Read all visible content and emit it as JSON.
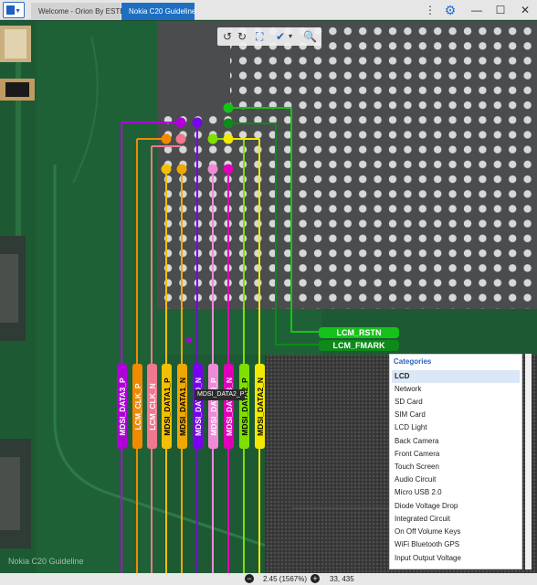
{
  "window": {
    "tabs": [
      {
        "label": "Welcome - Orion By ESTECH"
      },
      {
        "label": "Nokia C20 Guideline"
      }
    ],
    "controls": {
      "more": "⋮",
      "minimize": "—",
      "maximize": "☐",
      "close": "✕"
    }
  },
  "toolbar": {
    "rotate_left": "↺",
    "rotate_right": "↻",
    "fit": "⛶",
    "check": "✔",
    "dropdown": "▾",
    "search": "🔍"
  },
  "signals_horizontal": [
    {
      "label": "LCM_RSTN",
      "color": "#16c21a"
    },
    {
      "label": "LCM_FMARK",
      "color": "#0d8a1a"
    }
  ],
  "signals_vertical": [
    {
      "label": "MDSI_DATA3_P",
      "color": "#b000d8",
      "text_color": "#ffffff"
    },
    {
      "label": "LCM_CLK_P",
      "color": "#f08a00",
      "text_color": "#ffffff"
    },
    {
      "label": "LCM_CLK_N",
      "color": "#f07890",
      "text_color": "#ffffff"
    },
    {
      "label": "MDSI_DATA1_P",
      "color": "#f2c000",
      "text_color": "#000000"
    },
    {
      "label": "MDSI_DATA1_N",
      "color": "#f0a800",
      "text_color": "#000000"
    },
    {
      "label": "MDSI_DATA0_N",
      "color": "#7a00f0",
      "text_color": "#ffffff"
    },
    {
      "label": "MDSI_DATA0_P",
      "color": "#f08ad8",
      "text_color": "#ffffff"
    },
    {
      "label": "MDSI_DATA3_N",
      "color": "#e000b8",
      "text_color": "#ffffff"
    },
    {
      "label": "MDSI_DATA2_P",
      "color": "#7fe000",
      "text_color": "#000000"
    },
    {
      "label": "MDSI_DATA2_N",
      "color": "#f2e800",
      "text_color": "#000000"
    }
  ],
  "tooltip": "MDSI_DATA2_P",
  "watermark": "Nokia C20 Guideline",
  "panel": {
    "title": "Categories",
    "items": [
      "LCD",
      "Network",
      "SD Card",
      "SIM Card",
      "LCD Light",
      "Back Camera",
      "Front Camera",
      "Touch Screen",
      "Audio Circuit",
      "Micro USB 2.0",
      "Diode Voltage Drop",
      "Integrated Circuit",
      "On Off Volume Keys",
      "WiFi Bluetooth GPS",
      "Input Output Voltage"
    ],
    "selected": "LCD"
  },
  "status": {
    "zoom": "2.45 (1567%)",
    "coords": "33, 435",
    "minus": "−",
    "plus": "+"
  }
}
